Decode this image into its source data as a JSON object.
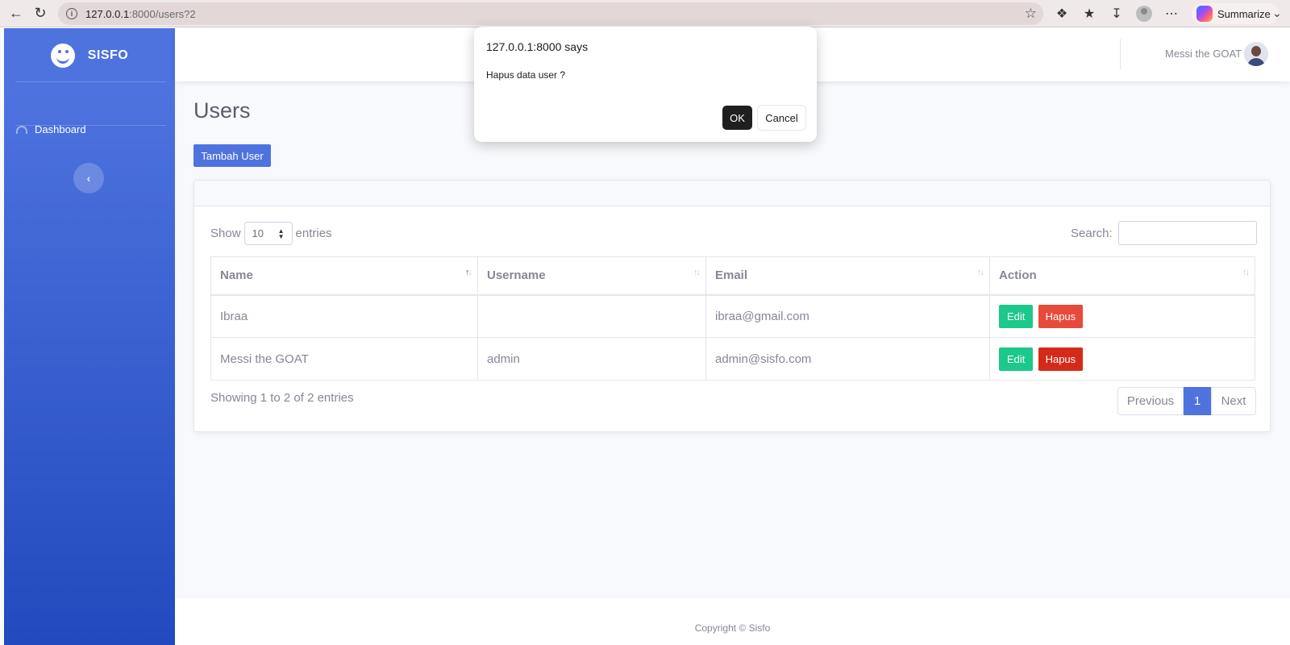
{
  "browser": {
    "url_host": "127.0.0.1",
    "url_path": ":8000/users?2",
    "summarize_label": "Summarize"
  },
  "sidebar": {
    "brand": "SISFO",
    "items": [
      {
        "label": "Dashboard",
        "icon": "tachometer-icon"
      }
    ],
    "toggle_icon": "chevron-left-icon"
  },
  "topbar": {
    "user_name": "Messi the GOAT"
  },
  "main": {
    "title": "Users",
    "add_button": "Tambah User",
    "show_label": "Show",
    "entries_value": "10",
    "entries_label": "entries",
    "search_label": "Search:",
    "columns": [
      "Name",
      "Username",
      "Email",
      "Action"
    ],
    "rows": [
      {
        "name": "Ibraa",
        "username": "",
        "email": "ibraa@gmail.com",
        "edit": "Edit",
        "delete": "Hapus"
      },
      {
        "name": "Messi the GOAT",
        "username": "admin",
        "email": "admin@sisfo.com",
        "edit": "Edit",
        "delete": "Hapus"
      }
    ],
    "info": "Showing 1 to 2 of 2 entries",
    "pagination": {
      "previous": "Previous",
      "current": "1",
      "next": "Next"
    }
  },
  "footer": {
    "copyright": "Copyright © Sisfo"
  },
  "dialog": {
    "title": "127.0.0.1:8000 says",
    "message": "Hapus data user ?",
    "ok": "OK",
    "cancel": "Cancel"
  },
  "colors": {
    "primary": "#4e73df",
    "success": "#1cc88a",
    "danger": "#e74a3b"
  }
}
